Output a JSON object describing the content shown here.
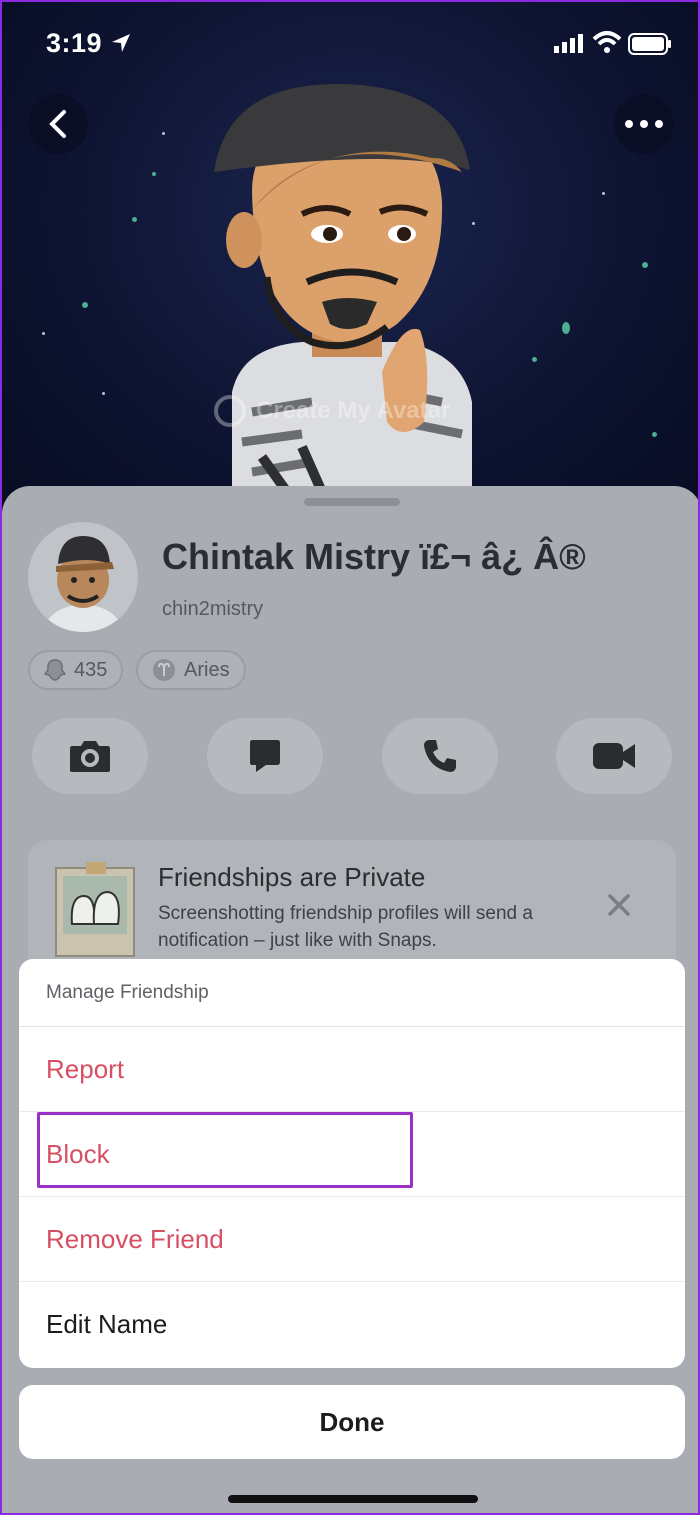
{
  "status_bar": {
    "time": "3:19"
  },
  "header": {
    "create_avatar_label": "Create My Avatar"
  },
  "profile": {
    "display_name": "Chintak Mistry ï£¬ â¿ Â®",
    "username": "chin2mistry",
    "snap_score": "435",
    "zodiac": "Aries"
  },
  "actions": [
    "camera-icon",
    "chat-icon",
    "phone-icon",
    "video-icon"
  ],
  "friendship_card": {
    "title": "Friendships are Private",
    "description": "Screenshotting friendship profiles will send a notification – just like with Snaps."
  },
  "manage_menu": {
    "header": "Manage Friendship",
    "items": [
      {
        "label": "Report",
        "color": "#d84f63"
      },
      {
        "label": "Block",
        "color": "#d84f63"
      },
      {
        "label": "Remove Friend",
        "color": "#d84f63"
      },
      {
        "label": "Edit Name",
        "color": "#1c1d20"
      }
    ],
    "done_label": "Done"
  },
  "colors": {
    "destructive": "#d84f63",
    "highlight": "#9b30c8"
  }
}
